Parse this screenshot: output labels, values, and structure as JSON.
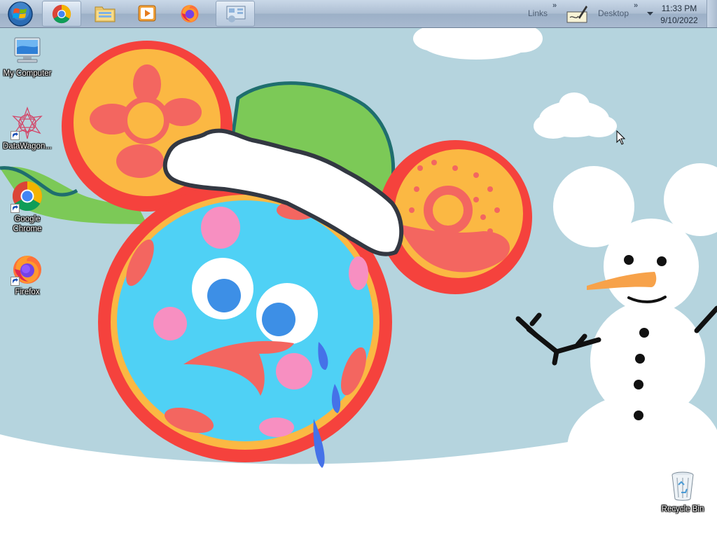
{
  "taskbar": {
    "start_icon": "windows-start-orb",
    "pinned": [
      {
        "name": "chrome-taskbar-button",
        "icon": "chrome-icon",
        "active": true
      },
      {
        "name": "explorer-taskbar-button",
        "icon": "folder-icon",
        "active": false
      },
      {
        "name": "media-player-taskbar-button",
        "icon": "media-player-icon",
        "active": false
      },
      {
        "name": "firefox-taskbar-button",
        "icon": "firefox-icon",
        "active": false
      },
      {
        "name": "network-taskbar-button",
        "icon": "network-icon",
        "active": true
      }
    ],
    "toolbars": {
      "links_label": "Links",
      "desktop_label": "Desktop",
      "chevron": "»"
    },
    "clock": {
      "time": "11:33 PM",
      "date": "9/10/2022"
    }
  },
  "desktop_icons": [
    {
      "label": "My Computer",
      "icon": "computer-icon",
      "shortcut": false
    },
    {
      "label": "DataWagon...",
      "icon": "datawagon-icon",
      "shortcut": true
    },
    {
      "label": "Google Chrome",
      "icon": "chrome-icon",
      "shortcut": true
    },
    {
      "label": "Firefox",
      "icon": "firefox-icon",
      "shortcut": true
    },
    {
      "label": "Recycle Bin",
      "icon": "recycle-bin-icon",
      "shortcut": false
    }
  ],
  "colors": {
    "sky": "#b5d4de",
    "snow": "#ffffff",
    "ear_orange": "#fbb843",
    "ear_red": "#f5423d",
    "face_blue": "#4fd1f5",
    "leaf_green": "#7cc957"
  }
}
